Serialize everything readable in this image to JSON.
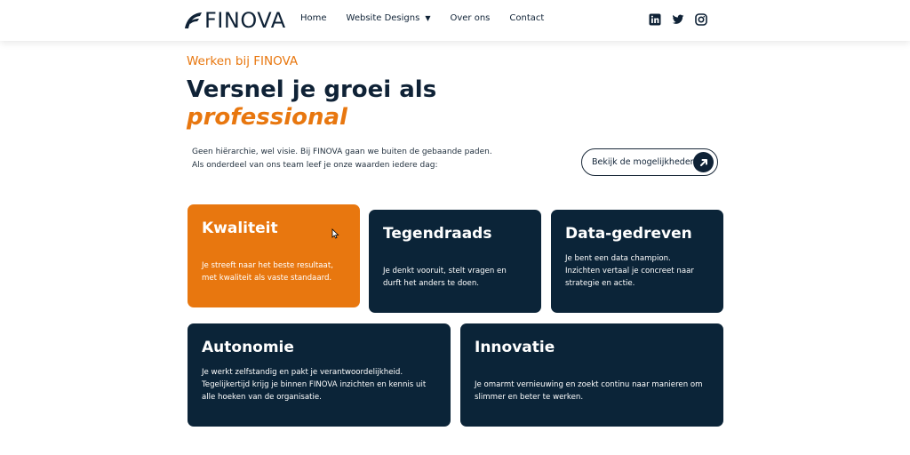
{
  "header": {
    "logo_text": "FINOVA",
    "nav": [
      {
        "label": "Home"
      },
      {
        "label": "Website Designs",
        "has_dropdown": true
      },
      {
        "label": "Over ons"
      },
      {
        "label": "Contact"
      }
    ],
    "socials": [
      "linkedin-icon",
      "twitter-icon",
      "instagram-icon"
    ]
  },
  "hero": {
    "eyebrow": "Werken bij FINOVA",
    "headline": "Versnel je groei als",
    "headline_accent": "professional",
    "intro_line1": "Geen hiërarchie, wel visie. Bij FINOVA gaan we buiten de gebaande paden.",
    "intro_line2": "Als onderdeel van ons team leef je onze waarden iedere dag:",
    "cta_label": "Bekijk de mogelijkheden",
    "cta_icon": "arrow-up-right-icon"
  },
  "cards": [
    {
      "title": "Kwaliteit",
      "text_lines": [
        "Je streeft naar het beste resultaat,",
        "met kwaliteit als vaste standaard."
      ]
    },
    {
      "title": "Tegendraads",
      "text_lines": [
        "Je denkt vooruit, stelt vragen en",
        "durft het anders te doen."
      ]
    },
    {
      "title": "Data-gedreven",
      "text_lines": [
        "Je bent een data champion.",
        "Inzichten vertaal je concreet naar",
        "strategie en actie."
      ]
    },
    {
      "title": "Autonomie",
      "text_lines": [
        "Je werkt zelfstandig en pakt je verantwoordelijkheid.",
        "Tegelijkertijd krijg je binnen FINOVA inzichten en kennis uit",
        "alle hoeken van de organisatie."
      ]
    },
    {
      "title": "Innovatie",
      "text_lines": [
        "Je omarmt vernieuwing en zoekt continu naar manieren om",
        "slimmer en beter te werken."
      ]
    }
  ],
  "colors": {
    "accent": "#e8770f",
    "navy": "#0b2438",
    "text": "#0f2236"
  }
}
